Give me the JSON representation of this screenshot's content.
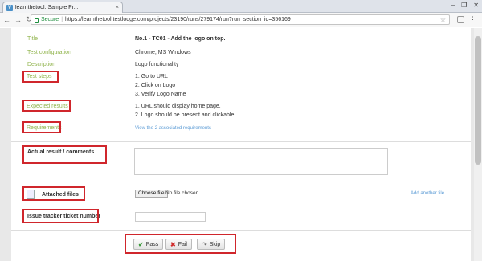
{
  "browser": {
    "tab_title": "learnthetool: Sample Pr...",
    "tab_favicon": "V",
    "tab_close": "×",
    "win_minimize": "–",
    "win_maximize": "❐",
    "win_close": "✕",
    "back": "←",
    "forward": "→",
    "reload": "↻",
    "secure_label": "Secure",
    "separator": "|",
    "url": "https://learnthetool.testlodge.com/projects/23190/runs/279174/run?run_section_id=356169",
    "star": "☆",
    "menu": "⋮"
  },
  "details": {
    "title_label": "Title",
    "title_value": "No.1 - TC01 - Add the logo on top.",
    "config_label": "Test configuration",
    "config_value": "Chrome, MS Windows",
    "description_label": "Description",
    "description_value": "Logo functionality",
    "steps_label": "Test steps",
    "steps": [
      "1. Go to URL",
      "2. Click on Logo",
      "3. Verify Logo Name"
    ],
    "expected_label": "Expected results",
    "expected": [
      "1. URL should display home page.",
      "2. Logo should be present and clickable."
    ],
    "requirements_label": "Requirements",
    "requirements_link": "View the 2 associated requirements"
  },
  "form": {
    "actual_label": "Actual result / comments",
    "attached_label": "Attached files",
    "choose_file": "Choose file",
    "no_file": "No file chosen",
    "add_another": "Add another file",
    "ticket_label": "Issue tracker ticket number"
  },
  "actions": {
    "pass_icon": "✔",
    "pass_label": "Pass",
    "fail_icon": "✖",
    "fail_label": "Fail",
    "skip_icon": "↷",
    "skip_label": "Skip"
  }
}
